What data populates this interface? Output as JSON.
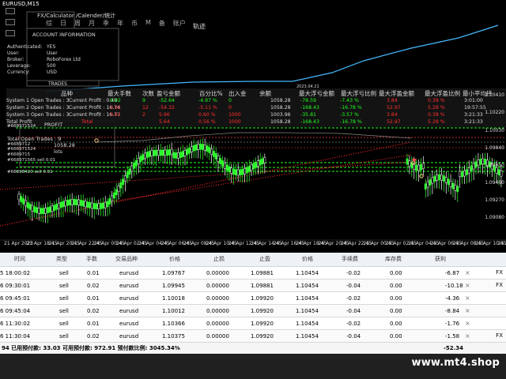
{
  "chart": {
    "title": "EURUSD,M15",
    "menu": {
      "items": [
        "综",
        "日",
        "周",
        "月",
        "季",
        "年",
        "币",
        "M",
        "备",
        "账户"
      ],
      "track": "轨迹"
    },
    "time_indicator": "FX/Calculator /Calender/统计",
    "account_information": "ACCOUNT INFORMATION",
    "account_labels": [
      "Authenticated:",
      "User:",
      "Broker:",
      "Leverage:",
      "Currency:"
    ],
    "account_values": [
      "YES",
      "User",
      "RoboForex Ltd",
      "500",
      "USD"
    ],
    "trades_label": "TRADES",
    "date_tip": "2023.04.21",
    "stats": {
      "headers": [
        "品种",
        "最大手数",
        "次数",
        "盈亏金额",
        "百分比%",
        "出入金",
        "余额",
        "最大浮亏金额",
        "最大浮亏比例",
        "最大浮盈金额",
        "最大浮盈比例",
        "最小平均持"
      ],
      "rows": [
        {
          "label": "System 1 Open Trades : 3",
          "info": "Current Profit : 0.49",
          "symbol": "EURUSD",
          "max_lots": "0.02",
          "count": "9",
          "profit": "-52.64",
          "percent": "-4.97 %",
          "deposit": "0",
          "balance": "1058.28",
          "max_float_loss": "-78.59",
          "max_float_loss_pct": "-7.43 %",
          "max_float_profit": "3.84",
          "max_float_profit_pct": "0.38 %",
          "avg_hold": "3:01:00"
        },
        {
          "label": "System 2 Open Trades : 3",
          "info": "Current Profit : 16.74",
          "symbol": "EURUSD",
          "max_lots": "0.02",
          "count": "12",
          "profit": "-54.32",
          "percent": "-5.11 %",
          "deposit": "0",
          "balance": "1058.28",
          "max_float_loss": "-168.43",
          "max_float_loss_pct": "-16.78 %",
          "max_float_profit": "52.97",
          "max_float_profit_pct": "5.28 %",
          "avg_hold": "19:57:55"
        },
        {
          "label": "System 3 Open Trades : 3",
          "info": "Current Profit : 16.77",
          "symbol": "EURUSD",
          "max_lots": "0.01",
          "count": "2",
          "profit": "5.96",
          "percent": "0.60 %",
          "deposit": "1000",
          "balance": "1003.96",
          "max_float_loss": "-35.81",
          "max_float_loss_pct": "-3.57 %",
          "max_float_profit": "3.84",
          "max_float_profit_pct": "0.38 %",
          "avg_hold": "3:21:33"
        },
        {
          "label": "Total Profit",
          "info": "",
          "symbol": "Total",
          "max_lots": "",
          "count": "",
          "profit": "5.64",
          "percent": "0.56 %",
          "deposit": "1000",
          "balance": "1058.28",
          "max_float_loss": "-168.43",
          "max_float_loss_pct": "-16.78 %",
          "max_float_profit": "52.97",
          "max_float_profit_pct": "5.28 %",
          "avg_hold": "3:21:33"
        }
      ]
    },
    "profit_label": "PROFIT",
    "total_open_trades": "Total Open Trades : 9",
    "total_profit_value": "1058.28",
    "lots_label": "lots",
    "ticket_labels": [
      "#668971524",
      "#6689712",
      "#668971524",
      "#6689715",
      "#668971565 sell 0.01",
      "#66898420 sell 0.01"
    ],
    "price_axis": [
      "1.10410",
      "1.10220",
      "1.10030",
      "1.09840",
      "1.09650",
      "1.09460",
      "1.09270",
      "1.09080"
    ],
    "time_axis": [
      "21 Apr 2023",
      "21 Apr 18:45",
      "21 Apr 20:45",
      "21 Apr 22:45",
      "24 Apr 00:45",
      "24 Apr 02:45",
      "24 Apr 04:45",
      "24 Apr 06:45",
      "24 Apr 08:45",
      "24 Apr 10:45",
      "24 Apr 12:45",
      "24 Apr 14:45",
      "24 Apr 16:45",
      "24 Apr 18:45",
      "24 Apr 20:45",
      "24 Apr 22:45",
      "25 Apr 00:45",
      "25 Apr 02:45",
      "25 Apr 04:45",
      "25 Apr 06:45",
      "25 Apr 08:45",
      "25 Apr 10:45",
      "25 Apr 12:45"
    ]
  },
  "table": {
    "columns": [
      "时间",
      "类型",
      "手数",
      "交易品种",
      "价格",
      "止损",
      "止盈",
      "价格",
      "手续费",
      "库存费",
      "获利"
    ],
    "rows": [
      {
        "time": "5 18:00:02",
        "type": "sell",
        "lots": "0.01",
        "symbol": "eurusd",
        "price": "1.09767",
        "sl": "0.00000",
        "tp": "1.09881",
        "price2": "1.10454",
        "commission": "-0.02",
        "swap": "0.00",
        "profit": "-6.87",
        "extra": "FX"
      },
      {
        "time": "6 09:30:01",
        "type": "sell",
        "lots": "0.02",
        "symbol": "eurusd",
        "price": "1.09945",
        "sl": "0.00000",
        "tp": "1.09881",
        "price2": "1.10454",
        "commission": "-0.04",
        "swap": "0.00",
        "profit": "-10.18",
        "extra": "FX"
      },
      {
        "time": "6 09:45:01",
        "type": "sell",
        "lots": "0.01",
        "symbol": "eurusd",
        "price": "1.10018",
        "sl": "0.00000",
        "tp": "1.09920",
        "price2": "1.10454",
        "commission": "-0.02",
        "swap": "0.00",
        "profit": "-4.36",
        "extra": ""
      },
      {
        "time": "6 09:45:04",
        "type": "sell",
        "lots": "0.02",
        "symbol": "eurusd",
        "price": "1.10012",
        "sl": "0.00000",
        "tp": "1.09920",
        "price2": "1.10454",
        "commission": "-0.04",
        "swap": "0.00",
        "profit": "-8.84",
        "extra": ""
      },
      {
        "time": "6 11:30:02",
        "type": "sell",
        "lots": "0.01",
        "symbol": "eurusd",
        "price": "1.10366",
        "sl": "0.00000",
        "tp": "1.09920",
        "price2": "1.10454",
        "commission": "-0.02",
        "swap": "0.00",
        "profit": "-1.76",
        "extra": ""
      },
      {
        "time": "6 11:30:04",
        "type": "sell",
        "lots": "0.02",
        "symbol": "eurusd",
        "price": "1.10375",
        "sl": "0.00000",
        "tp": "1.09920",
        "price2": "1.10454",
        "commission": "-0.04",
        "swap": "0.00",
        "profit": "-1.58",
        "extra": "FX"
      },
      {
        "time": "6 11:30:06",
        "type": "sell",
        "lots": "0.01",
        "symbol": "eurusd",
        "price": "1.10373",
        "sl": "0.00000",
        "tp": "1.09920",
        "price2": "1.10454",
        "commission": "-0.02",
        "swap": "0.00",
        "profit": "-0.75",
        "extra": ""
      }
    ],
    "summary": {
      "margin_label": "94  已用预付款: 33.03  可用预付款: 972.91  预付款比例: 3045.34%",
      "total": "-52.34"
    }
  },
  "watermark": "www.mt4.shop"
}
